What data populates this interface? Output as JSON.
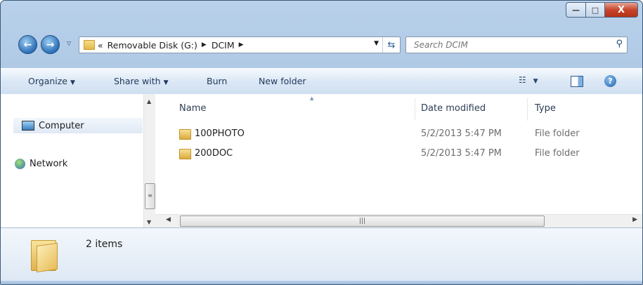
{
  "window": {
    "buttons": {
      "minimize": "—",
      "maximize": "□",
      "close": "X"
    }
  },
  "nav": {
    "back_icon": "back-arrow-icon",
    "forward_icon": "forward-arrow-icon",
    "breadcrumb": {
      "prefix": "«",
      "items": [
        "Removable Disk (G:)",
        "DCIM"
      ]
    },
    "search_placeholder": "Search DCIM"
  },
  "toolbar": {
    "organize": "Organize",
    "share_with": "Share with",
    "burn": "Burn",
    "new_folder": "New folder"
  },
  "sidebar": {
    "items": [
      {
        "label": "Computer",
        "icon": "computer-icon"
      },
      {
        "label": "Network",
        "icon": "network-icon"
      }
    ]
  },
  "columns": [
    "Name",
    "Date modified",
    "Type"
  ],
  "files": [
    {
      "name": "100PHOTO",
      "date": "5/2/2013 5:47 PM",
      "type": "File folder"
    },
    {
      "name": "200DOC",
      "date": "5/2/2013 5:47 PM",
      "type": "File folder"
    }
  ],
  "details": {
    "count": "2 items"
  },
  "colors": {
    "accent": "#1e395b",
    "frame": "#b9d1ea",
    "close": "#c7452c"
  }
}
